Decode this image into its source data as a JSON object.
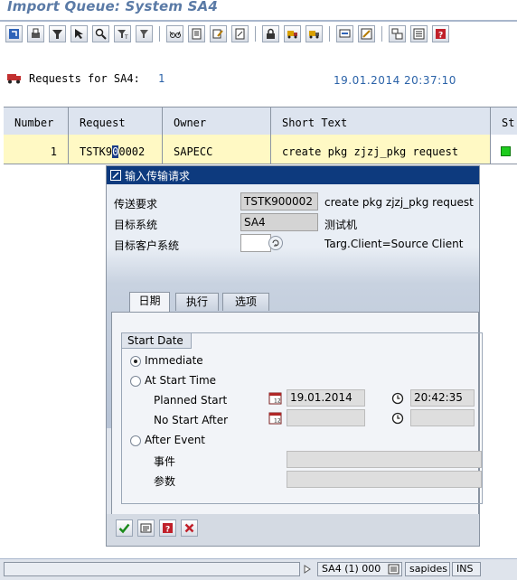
{
  "window": {
    "title": "Import Queue: System SA4"
  },
  "toolbar": {
    "buttons": [
      "refresh-icon",
      "print-icon",
      "filter-icon",
      "select-icon",
      "zoom-icon",
      "set-filter-icon",
      "sort-icon",
      "glasses-icon",
      "details-icon",
      "edit-icon",
      "document-icon",
      "lock-icon",
      "truck-icon",
      "truck-all-icon",
      "display-icon",
      "settings-icon",
      "tree-icon",
      "list-icon",
      "help-icon"
    ]
  },
  "header": {
    "requests_label": "Requests for SA4:",
    "requests_count": "1",
    "datetime": "19.01.2014 20:37:10"
  },
  "table": {
    "columns": [
      "Number",
      "Request",
      "Owner",
      "Short Text",
      "St"
    ],
    "rows": [
      {
        "number": "1",
        "request_pre": "TSTK9",
        "request_cursor": "0",
        "request_post": "0002",
        "owner": "SAPECC",
        "short_text": "create pkg zjzj_pkg request",
        "status": "green"
      }
    ]
  },
  "dialog": {
    "title": "输入传输请求",
    "fields": {
      "transport_request_label": "传送要求",
      "transport_request_value": "TSTK900002",
      "transport_request_text": "create pkg zjzj_pkg request",
      "target_system_label": "目标系统",
      "target_system_value": "SA4",
      "target_system_text": "测试机",
      "target_client_label": "目标客户系统",
      "target_client_value": "",
      "target_client_text": "Targ.Client=Source Client"
    },
    "tabs": [
      "日期",
      "执行",
      "选项"
    ],
    "active_tab": "日期",
    "start_date": {
      "group_title": "Start Date",
      "options": {
        "immediate": "Immediate",
        "at_start_time": "At Start Time",
        "after_event": "After Event"
      },
      "selected": "immediate",
      "planned_start_label": "Planned Start",
      "planned_start_date": "19.01.2014",
      "planned_start_time": "20:42:35",
      "no_start_after_label": "No Start After",
      "no_start_after_date": "",
      "no_start_after_time": "",
      "event_label": "事件",
      "event_value": "",
      "param_label": "参数",
      "param_value": ""
    },
    "footer_buttons": [
      "confirm-icon",
      "schedule-icon",
      "info-icon",
      "cancel-icon"
    ]
  },
  "statusbar": {
    "system": "SA4 (1) 000",
    "server": "sapides",
    "mode": "INS"
  },
  "colors": {
    "title_blue": "#5a7aa6",
    "dialog_title_bg": "#0d3a7e",
    "highlight_yellow": "#fff9c4",
    "status_green": "#1ecb1e",
    "value_blue": "#2a62a8"
  }
}
